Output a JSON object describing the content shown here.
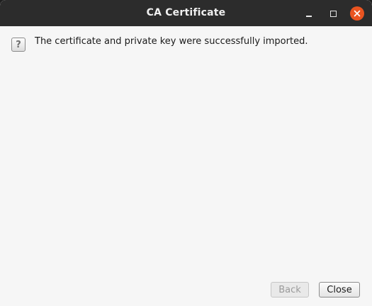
{
  "window": {
    "title": "CA Certificate"
  },
  "titlebar_buttons": {
    "minimize_icon": "minimize-icon",
    "maximize_icon": "maximize-icon",
    "close_icon": "close-icon",
    "close_color": "#e95420"
  },
  "dialog": {
    "icon_glyph": "?",
    "icon_name": "question-icon",
    "message": "The certificate and private key were successfully imported."
  },
  "buttons": {
    "back_label": "Back",
    "back_enabled": false,
    "close_label": "Close"
  }
}
